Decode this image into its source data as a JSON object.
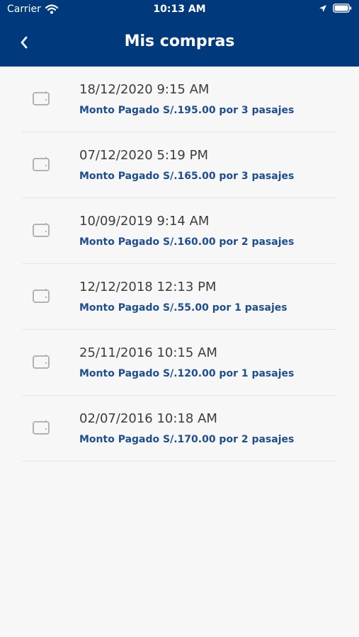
{
  "status_bar": {
    "carrier": "Carrier",
    "time": "10:13 AM"
  },
  "nav": {
    "title": "Mis compras"
  },
  "purchases": [
    {
      "date": "18/12/2020 9:15 AM",
      "amount": "Monto Pagado S/.195.00 por 3 pasajes"
    },
    {
      "date": "07/12/2020 5:19 PM",
      "amount": "Monto Pagado S/.165.00 por 3 pasajes"
    },
    {
      "date": "10/09/2019 9:14 AM",
      "amount": "Monto Pagado S/.160.00 por 2 pasajes"
    },
    {
      "date": "12/12/2018 12:13 PM",
      "amount": "Monto Pagado S/.55.00 por 1 pasajes"
    },
    {
      "date": "25/11/2016 10:15 AM",
      "amount": "Monto Pagado S/.120.00 por 1 pasajes"
    },
    {
      "date": "02/07/2016 10:18 AM",
      "amount": "Monto Pagado S/.170.00 por 2 pasajes"
    }
  ],
  "colors": {
    "header_bg": "#003a7d",
    "amount_text": "#1d4e8f"
  }
}
